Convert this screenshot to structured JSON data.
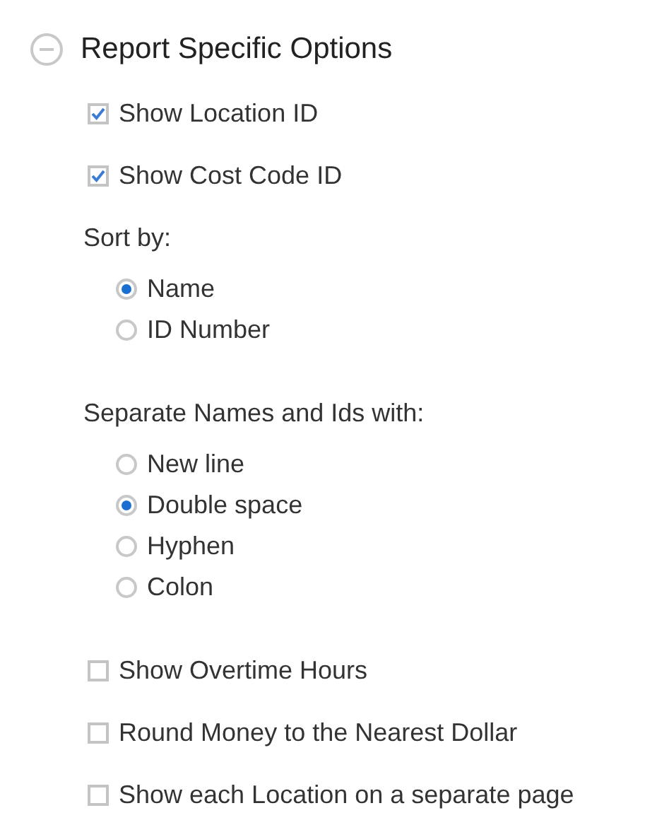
{
  "section": {
    "title": "Report Specific Options",
    "expanded": true,
    "items": [
      {
        "kind": "checkbox",
        "label": "Show Location ID",
        "checked": true
      },
      {
        "kind": "checkbox",
        "label": "Show Cost Code ID",
        "checked": true
      },
      {
        "kind": "radio_group",
        "label": "Sort by:",
        "options": [
          {
            "label": "Name",
            "selected": true
          },
          {
            "label": "ID Number",
            "selected": false
          }
        ]
      },
      {
        "kind": "radio_group",
        "label": "Separate Names and Ids with:",
        "options": [
          {
            "label": "New line",
            "selected": false
          },
          {
            "label": "Double space",
            "selected": true
          },
          {
            "label": "Hyphen",
            "selected": false
          },
          {
            "label": "Colon",
            "selected": false
          }
        ]
      },
      {
        "kind": "checkbox",
        "label": "Show Overtime Hours",
        "checked": false
      },
      {
        "kind": "checkbox",
        "label": "Round Money to the Nearest Dollar",
        "checked": false
      },
      {
        "kind": "checkbox",
        "label": "Show each Location on a separate page",
        "checked": false
      }
    ]
  }
}
